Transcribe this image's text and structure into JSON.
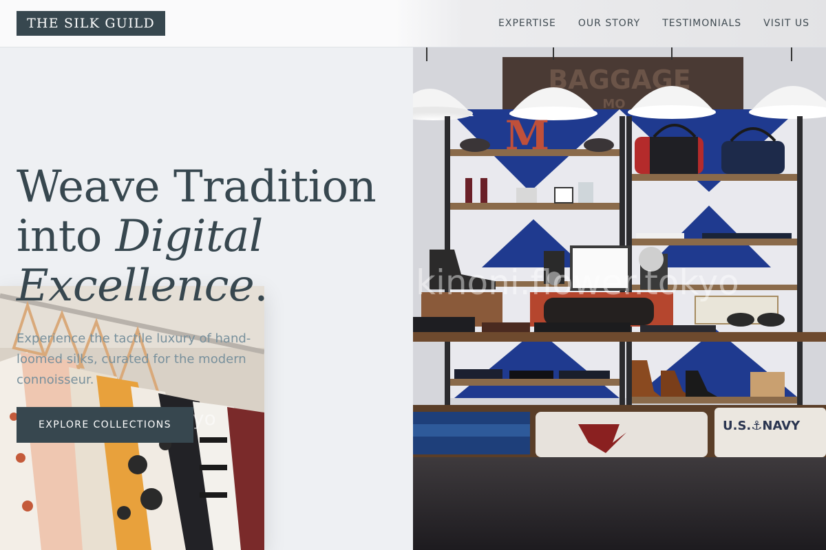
{
  "header": {
    "logo": "THE SILK GUILD",
    "nav": [
      "EXPERTISE",
      "OUR STORY",
      "TESTIMONIALS",
      "VISIT US"
    ]
  },
  "hero": {
    "headline_line1": "Weave Tradition",
    "headline_line2a": "into ",
    "headline_line2b": "Digital",
    "headline_line3": "Excellence",
    "headline_period": ".",
    "subtext": "Experience the tactile luxury of hand-loomed silks, curated for the modern connoisseur.",
    "cta_label": "EXPLORE COLLECTIONS"
  },
  "images": {
    "shop_sign": "BAGGAGE",
    "shop_sign_sub": "MO",
    "shelf_letter": "M",
    "navy_shirt": "U.S.⚓NAVY",
    "watermark": "kinoni.flower.tokyo",
    "watermark_fragment": "yo"
  },
  "colors": {
    "primary": "#37474f",
    "muted": "#78909c",
    "background": "#eef0f3"
  }
}
